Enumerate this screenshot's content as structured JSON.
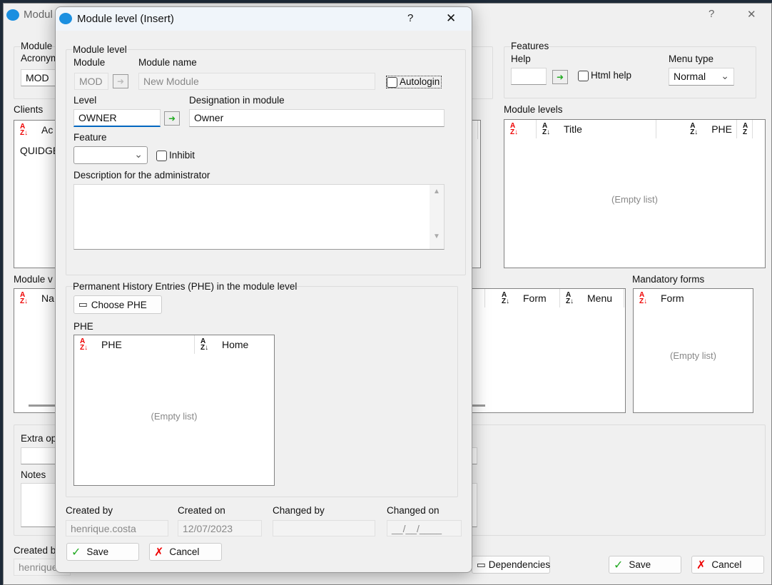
{
  "bg": {
    "title": "Modul",
    "help": "?",
    "close": "✕",
    "module_group": "Module",
    "acronym_label": "Acronym",
    "acronym": "MOD",
    "features": {
      "title": "Features",
      "help_label": "Help",
      "html_help": "Html help",
      "menu_type_label": "Menu type",
      "menu_type": "Normal"
    },
    "clients_label": "Clients",
    "clients_col": "Ac",
    "clients_row": "QUIDGE",
    "module_levels": {
      "label": "Module levels",
      "cols": [
        "Title",
        "PHE"
      ],
      "empty": "(Empty list)"
    },
    "module_v_label": "Module v",
    "module_v_cols": [
      "Na",
      "Form",
      "Menu"
    ],
    "mandatory": {
      "label": "Mandatory forms",
      "col": "Form",
      "empty": "(Empty list)"
    },
    "extra_label": "Extra op",
    "notes_label": "Notes",
    "created_by_label": "Created b",
    "created_by": "henrique",
    "dependencies": "Dependencies",
    "save": "Save",
    "cancel": "Cancel"
  },
  "dialog": {
    "title": "Module level (Insert)",
    "help": "?",
    "close": "✕",
    "group": "Module level",
    "module_label": "Module",
    "module": "MOD",
    "module_name_label": "Module name",
    "module_name": "New Module",
    "autologin": "Autologin",
    "level_label": "Level",
    "level": "OWNER",
    "designation_label": "Designation in module",
    "designation": "Owner",
    "feature_label": "Feature",
    "inhibit": "Inhibit",
    "desc_label": "Description for the administrator",
    "phe_group": "Permanent History Entries (PHE) in the module level",
    "choose_phe": "Choose PHE",
    "phe_label": "PHE",
    "phe_cols": [
      "PHE",
      "Home"
    ],
    "phe_empty": "(Empty list)",
    "created_by_label": "Created by",
    "created_by": "henrique.costa",
    "created_on_label": "Created on",
    "created_on": "12/07/2023",
    "changed_by_label": "Changed by",
    "changed_by": "",
    "changed_on_label": "Changed on",
    "changed_on": "__/__/____",
    "save": "Save",
    "cancel": "Cancel"
  }
}
